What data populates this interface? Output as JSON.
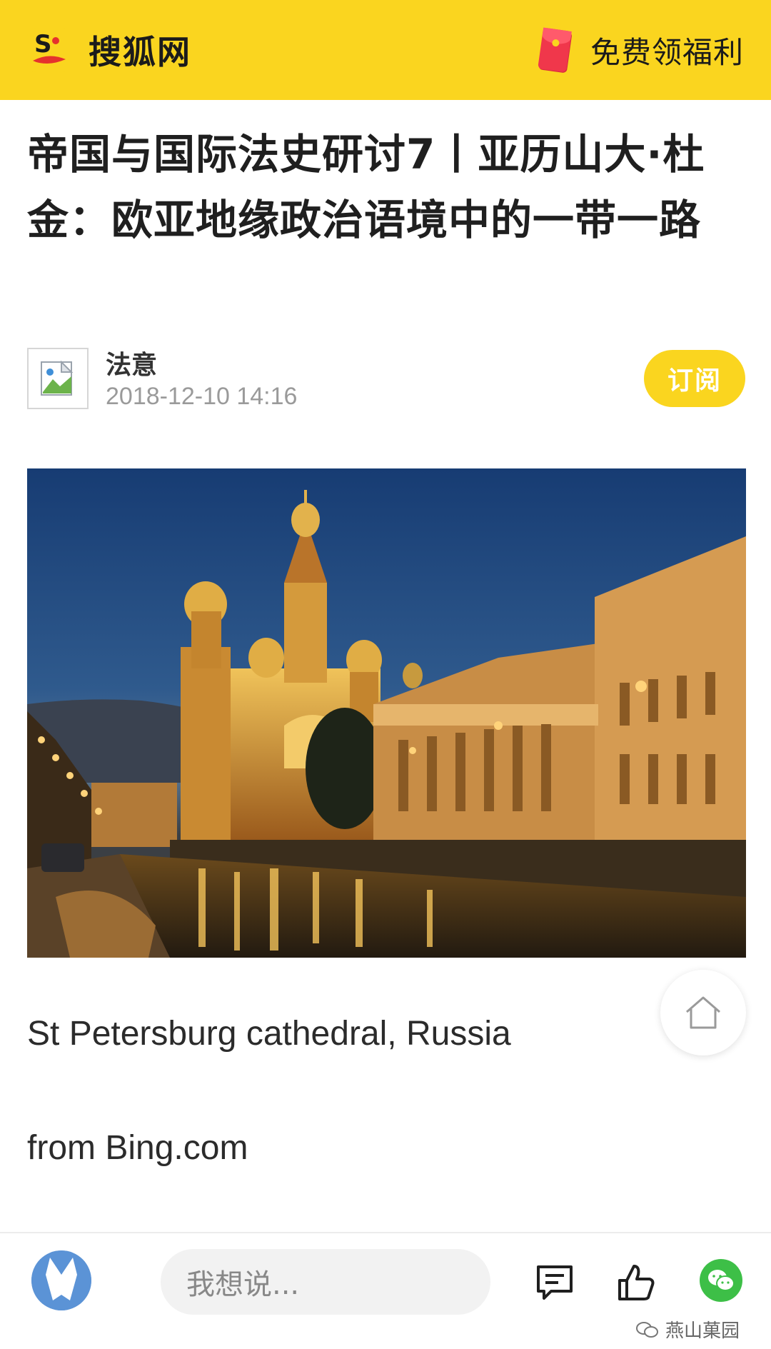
{
  "header": {
    "logo_letter": "S",
    "site_name": "搜狐网",
    "promo_label": "免费领福利",
    "brand_color": "#fad51f"
  },
  "article": {
    "title": "帝国与国际法史研讨7丨亚历山大·杜金：欧亚地缘政治语境中的一带一路",
    "author": "法意",
    "datetime": "2018-12-10 14:16",
    "subscribe_label": "订阅",
    "caption": "St Petersburg cathedral, Russia",
    "source": "from Bing.com"
  },
  "icons": {
    "home": "home-icon",
    "comment": "comment-icon",
    "like": "thumbs-up-icon",
    "share": "wechat-icon"
  },
  "bottom_bar": {
    "input_placeholder": "我想说...",
    "watermark": "燕山菓园"
  }
}
